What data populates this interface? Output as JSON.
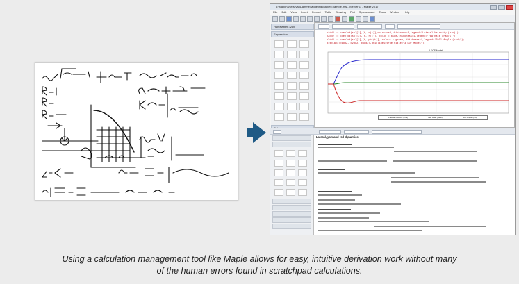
{
  "app": {
    "title": "L:\\Maple\\Users\\VanDamme\\Modeling\\Maple\\Example.mw - [Server 1] - Maple 2017",
    "menu": [
      "File",
      "Edit",
      "View",
      "Insert",
      "Format",
      "Table",
      "Drawing",
      "Plot",
      "Spreadsheet",
      "Tools",
      "Window",
      "Help"
    ],
    "palette_top": [
      "Handwritten (2D)",
      "Expression"
    ],
    "palette_bottom": [
      "Calculus",
      "Common Symbols",
      "Greek",
      "Units (SI)",
      "Components"
    ],
    "code_lines": [
      "p1dd2 := odeplot(sol[2],[t, c(t)],color=red,thickness=1,legend='Lateral Velocity (m/s)');",
      "p2dd2 := odeplot(sol[2],[t, r(t)], color = blue,thickness=1,legend='Yaw Rate (rad/s)');",
      "p3dd2 := odeplot(sol[2],[t, phi(t)], colour = green, thickness=1,legend='Roll Angle (rad)');",
      "",
      "display([p1dd2, p2dd2, p3dd2],gridlines=true,title=\"3 DOF Model\");"
    ],
    "plot_title": "3 DOF Model",
    "legend": [
      "Lateral Velocity (m/s)",
      "Yaw Rate (rad/s)",
      "Roll Angle (rad)"
    ],
    "section_title": "Lateral, yaw and roll dynamics",
    "colors": {
      "roll": "#2d8a2d",
      "yaw": "#2222cc",
      "lateral": "#cc2222",
      "arrow": "#1f5a85"
    }
  },
  "caption": {
    "line1": "Using a calculation management tool like Maple allows for easy, intuitive derivation work without many",
    "line2": "of the human errors found in scratchpad calculations."
  }
}
